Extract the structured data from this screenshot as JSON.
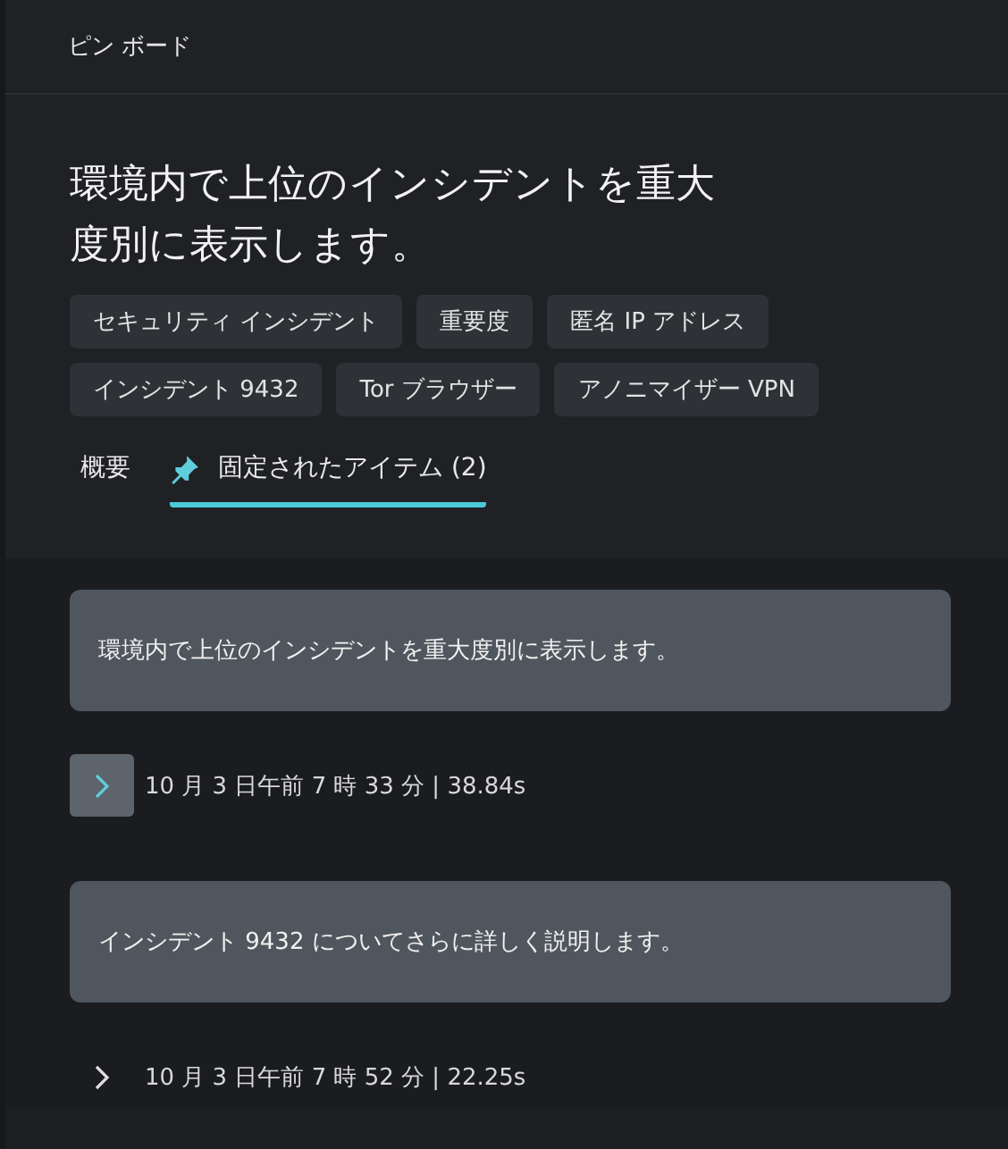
{
  "header": {
    "title": "ピン ボード"
  },
  "heading": "環境内で上位のインシデントを重大度別に表示します。",
  "tags": [
    "セキュリティ インシデント",
    "重要度",
    "匿名 IP アドレス",
    "インシデント 9432",
    "Tor ブラウザー",
    "アノニマイザー VPN"
  ],
  "tabs": [
    {
      "label": "概要",
      "selected": false,
      "kind": "text"
    },
    {
      "label": "固定されたアイテム (2)",
      "selected": true,
      "kind": "pinned"
    }
  ],
  "items": [
    {
      "text": "環境内で上位のインシデントを重大度別に表示します。",
      "timestamp": "10 月 3 日午前 7 時 33 分 | 38.84s",
      "selected": true
    },
    {
      "text": "インシデント 9432 についてさらに詳しく説明します。",
      "timestamp": "10 月 3 日午前 7 時 52 分 | 22.25s",
      "selected": false
    }
  ]
}
